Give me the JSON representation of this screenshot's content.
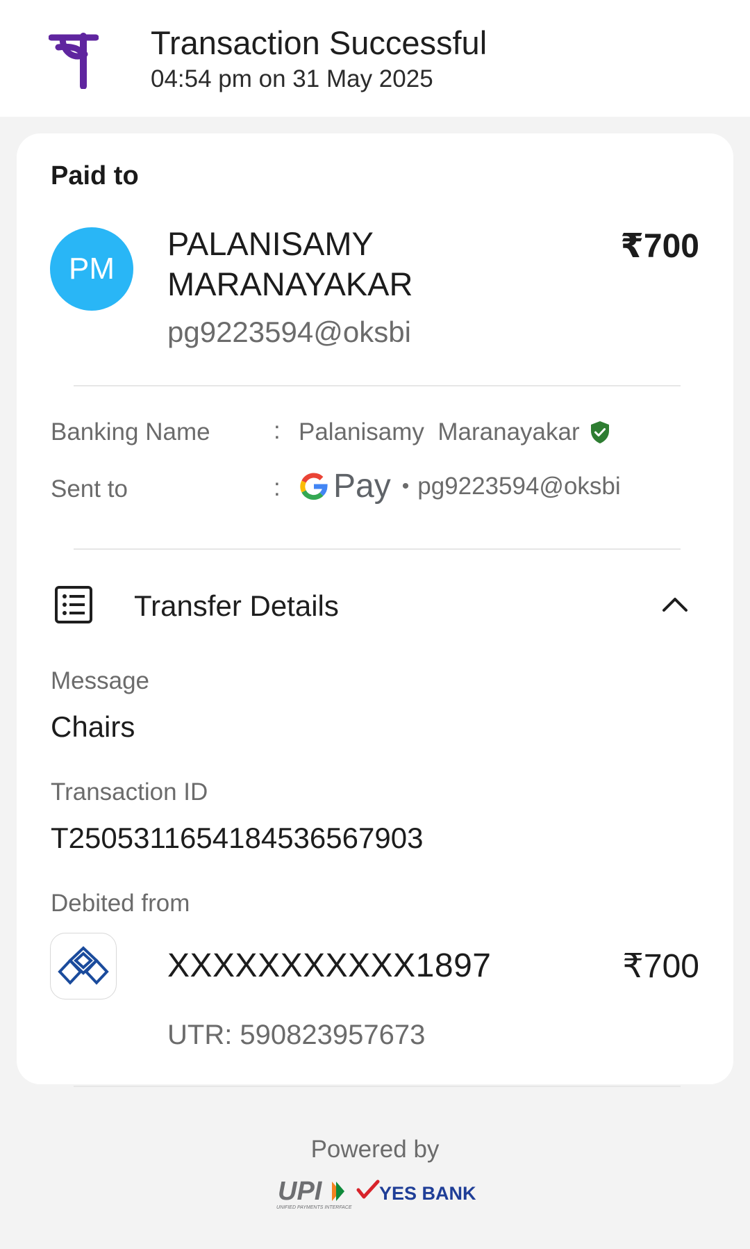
{
  "header": {
    "title": "Transaction Successful",
    "subtitle": "04:54 pm on 31 May 2025",
    "logo_icon": "phonepe-logo-icon",
    "brand_color": "#5f259f"
  },
  "payee": {
    "section_label": "Paid to",
    "initials": "PM",
    "name": "PALANISAMY MARANAYAKAR",
    "amount": "₹700",
    "vpa": "pg9223594@oksbi",
    "avatar_color": "#29b6f6"
  },
  "details": {
    "banking_name_label": "Banking Name",
    "banking_name_value": "Palanisamy  Maranayakar",
    "verified_icon": "verified-shield-icon",
    "verified_color": "#2e7d32",
    "sent_to_label": "Sent to",
    "sent_to_app": "Pay",
    "sent_to_app_icon": "google-g-icon",
    "sent_to_vpa": "pg9223594@oksbi",
    "separator": ":"
  },
  "transfer": {
    "title": "Transfer Details",
    "icon": "receipt-list-icon",
    "toggle_icon": "chevron-up-icon",
    "message_label": "Message",
    "message_value": "Chairs",
    "txn_id_label": "Transaction ID",
    "txn_id_value": "T2505311654184536567903",
    "debited_label": "Debited from",
    "bank_icon": "bank-of-india-logo-icon",
    "account": "XXXXXXXXXXX1897",
    "account_amount": "₹700",
    "utr": "UTR: 590823957673"
  },
  "footer": {
    "powered_by": "Powered by",
    "upi_logo": "UPI",
    "upi_tagline": "UNIFIED PAYMENTS INTERFACE",
    "bank_logo": "YES BANK"
  }
}
